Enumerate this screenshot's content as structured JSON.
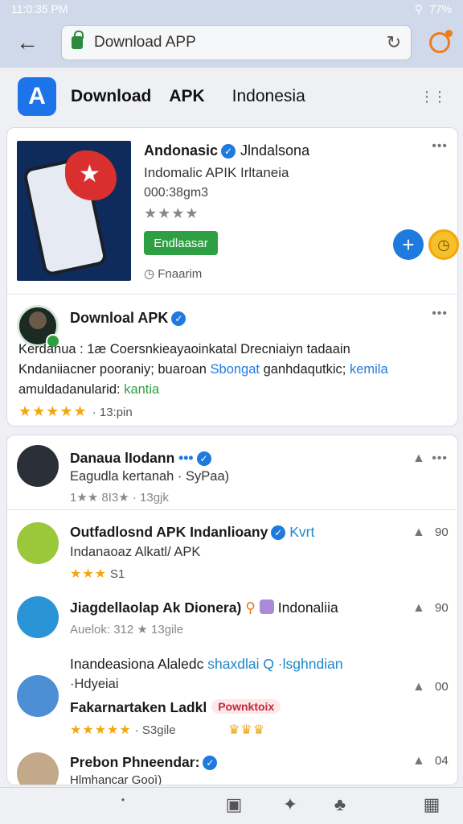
{
  "status": {
    "time": "11:0:35 PM",
    "battery": "77%"
  },
  "browser": {
    "url_text": "Download APP",
    "back": "←",
    "reload": "↻"
  },
  "app_header": {
    "tabs": [
      "Download",
      "APK",
      "Indonesia"
    ]
  },
  "featured": {
    "title": "Andonasic",
    "title_extra": "Jlndalsona",
    "subtitle": "Indomalic APIK Irltaneia",
    "code": "000:38gm3",
    "stars_text": "★★★★",
    "install_label": "Endlaasar",
    "meta": "Fnaarim"
  },
  "post": {
    "name": "Downloal APK",
    "line1": "Kerdanua : 1æ Coersnkieayaoinkatal Drecniaiyn tadaain",
    "line2a": "Kndaniiacner pooraniy; buaroan",
    "line2b": "Sbongat",
    "line2c": "ganhdaqutkic;",
    "line2d": "kemila",
    "line3a": "amuldadanularid:",
    "line3b": "kantia",
    "stars": "★★★★★",
    "time": "· 13:pin"
  },
  "list": [
    {
      "title": "Danaua lIodann",
      "sub": "Eagudla kertanah · SyPaa)",
      "meta": "1★★ 8I3★ · 13gjk",
      "count": ""
    },
    {
      "title": "Outfadlosnd APK Indanlioany",
      "title_extra": "Kvrt",
      "sub": "Indanaoaz Alkatl/ APK",
      "meta": "★★★",
      "meta_text": "S1",
      "count": "90"
    },
    {
      "title": "Jiagdellaolap Ak Dionera)",
      "title_extra": "Indonaliia",
      "sub": "Auelok: 312 ★ 13gile",
      "count": "90"
    },
    {
      "title": "Inandeasiona Alaledc",
      "title_extra": "shaxdlai Q ·lsghndian",
      "sub": "·Hdyeiai",
      "line3": "Fakarnartaken Ladkl",
      "pill": "Pownktoix",
      "meta": "★★★★★",
      "meta_text": "· S3gile",
      "count": "00"
    },
    {
      "title": "Prebon Phneendar:",
      "sub": "Hlmhancar Gooì)",
      "count": "04"
    }
  ],
  "nav": [
    "cube-icon",
    "puzzle-icon",
    "shield-icon",
    "settings-board-icon"
  ]
}
